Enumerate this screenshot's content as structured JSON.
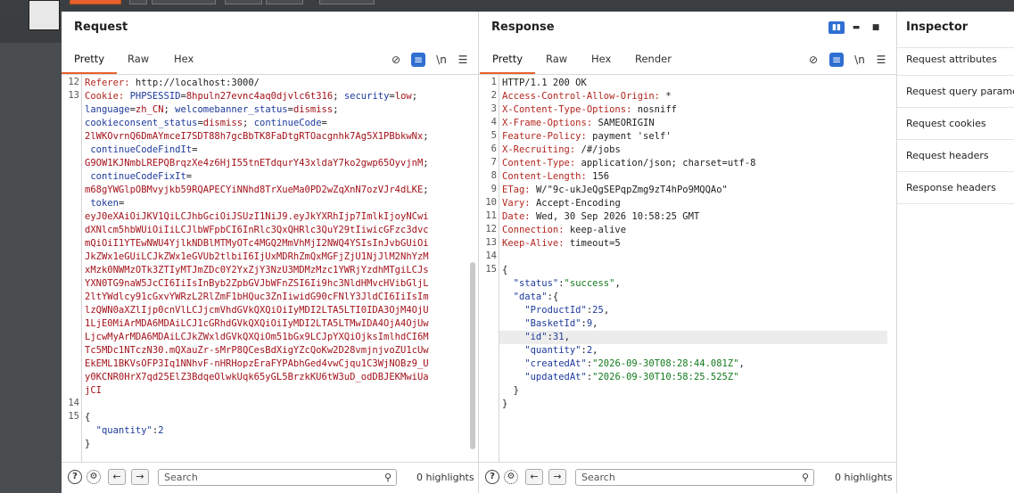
{
  "request": {
    "title": "Request",
    "tabs": [
      "Pretty",
      "Raw",
      "Hex"
    ],
    "lines": [
      {
        "n": "12",
        "segs": [
          {
            "t": "Referer: ",
            "c": "k"
          },
          {
            "t": "http://localhost:3000/",
            "c": "v"
          }
        ]
      },
      {
        "n": "13",
        "segs": [
          {
            "t": "Cookie: ",
            "c": "k"
          },
          {
            "t": "PHPSESSID",
            "c": "blue"
          },
          {
            "t": "=",
            "c": "v"
          },
          {
            "t": "8hpuln27evnc4aq0djvlc6t316",
            "c": "red"
          },
          {
            "t": "; ",
            "c": "v"
          },
          {
            "t": "security",
            "c": "blue"
          },
          {
            "t": "=",
            "c": "v"
          },
          {
            "t": "low",
            "c": "red"
          },
          {
            "t": ";",
            "c": "v"
          }
        ]
      },
      {
        "n": "",
        "segs": [
          {
            "t": "language",
            "c": "blue"
          },
          {
            "t": "=",
            "c": "v"
          },
          {
            "t": "zh_CN",
            "c": "red"
          },
          {
            "t": "; ",
            "c": "v"
          },
          {
            "t": "welcomebanner_status",
            "c": "blue"
          },
          {
            "t": "=",
            "c": "v"
          },
          {
            "t": "dismiss",
            "c": "red"
          },
          {
            "t": ";",
            "c": "v"
          }
        ]
      },
      {
        "n": "",
        "segs": [
          {
            "t": "cookieconsent_status",
            "c": "blue"
          },
          {
            "t": "=",
            "c": "v"
          },
          {
            "t": "dismiss",
            "c": "red"
          },
          {
            "t": "; ",
            "c": "v"
          },
          {
            "t": "continueCode",
            "c": "blue"
          },
          {
            "t": "=",
            "c": "v"
          }
        ]
      },
      {
        "n": "",
        "segs": [
          {
            "t": "2lWKOvrnQ6DmAYmceI7SDT88h7gcBbTK8FaDtgRTOacgnhk7Ag5X1PBbkwNx",
            "c": "red"
          },
          {
            "t": ";",
            "c": "v"
          }
        ]
      },
      {
        "n": "",
        "segs": [
          {
            "t": " continueCodeFindIt",
            "c": "blue"
          },
          {
            "t": "=",
            "c": "v"
          }
        ]
      },
      {
        "n": "",
        "segs": [
          {
            "t": "G9OW1KJNmbLREPQBrqzXe4z6HjI55tnETdqurY43xldaY7ko2gwp65OyvjnM",
            "c": "red"
          },
          {
            "t": ";",
            "c": "v"
          }
        ]
      },
      {
        "n": "",
        "segs": [
          {
            "t": " continueCodeFixIt",
            "c": "blue"
          },
          {
            "t": "=",
            "c": "v"
          }
        ]
      },
      {
        "n": "",
        "segs": [
          {
            "t": "m68gYWGlpOBMvyjkb59RQAPECYiNNhd8TrXueMa0PD2wZqXnN7ozVJr4dLKE",
            "c": "red"
          },
          {
            "t": ";",
            "c": "v"
          }
        ]
      },
      {
        "n": "",
        "segs": [
          {
            "t": " token",
            "c": "blue"
          },
          {
            "t": "=",
            "c": "v"
          }
        ]
      },
      {
        "n": "",
        "segs": [
          {
            "t": "eyJ0eXAiOiJKV1QiLCJhbGciOiJSUzI1NiJ9.eyJkYXRhIjp7ImlkIjoyNCwi",
            "c": "red"
          }
        ]
      },
      {
        "n": "",
        "segs": [
          {
            "t": "dXNlcm5hbWUiOiIiLCJlbWFpbCI6InRlc3QxQHRlc3QuY29tIiwicGFzc3dvc",
            "c": "red"
          }
        ]
      },
      {
        "n": "",
        "segs": [
          {
            "t": "mQiOiI1YTEwNWU4YjlkNDBlMTMyOTc4MGQ2MmVhMjI2NWQ4YSIsInJvbGUiOi",
            "c": "red"
          }
        ]
      },
      {
        "n": "",
        "segs": [
          {
            "t": "JkZWx1eGUiLCJkZWx1eGVUb2tlbiI6IjUxMDRhZmQxMGFjZjU1NjJlM2NhYzM",
            "c": "red"
          }
        ]
      },
      {
        "n": "",
        "segs": [
          {
            "t": "xMzk0NWMzOTk3ZTIyMTJmZDc0Y2YxZjY3NzU3MDMzMzc1YWRjYzdhMTgiLCJs",
            "c": "red"
          }
        ]
      },
      {
        "n": "",
        "segs": [
          {
            "t": "YXN0TG9naW5JcCI6IiIsInByb2ZpbGVJbWFnZSI6Ii9hc3NldHMvcHVibGljL",
            "c": "red"
          }
        ]
      },
      {
        "n": "",
        "segs": [
          {
            "t": "2ltYWdlcy91cGxvYWRzL2RlZmF1bHQuc3ZnIiwidG90cFNlY3JldCI6IiIsIm",
            "c": "red"
          }
        ]
      },
      {
        "n": "",
        "segs": [
          {
            "t": "lzQWN0aXZlIjp0cnVlLCJjcmVhdGVkQXQiOiIyMDI2LTA5LTI0IDA3OjM4OjU",
            "c": "red"
          }
        ]
      },
      {
        "n": "",
        "segs": [
          {
            "t": "1LjE0MiArMDA6MDAiLCJ1cGRhdGVkQXQiOiIyMDI2LTA5LTMwIDA4OjA4OjUw",
            "c": "red"
          }
        ]
      },
      {
        "n": "",
        "segs": [
          {
            "t": "LjcwMyArMDA6MDAiLCJkZWxldGVkQXQiOm51bGx9LCJpYXQiOjksImlhdCI6M",
            "c": "red"
          }
        ]
      },
      {
        "n": "",
        "segs": [
          {
            "t": "Tc5MDc1NTczN30.mQXauZr-sMrP8QCesBdXigYZcQoKw2D28vmjnjvoZU1cUw",
            "c": "red"
          }
        ]
      },
      {
        "n": "",
        "segs": [
          {
            "t": "EkEML1BKVsOFP3Iq1NNhvF-nHRHopzEraFYPAbhGed4vwCjqu1C3WjNOBz9_U",
            "c": "red"
          }
        ]
      },
      {
        "n": "",
        "segs": [
          {
            "t": "y0KCNR0HrX7qd25ElZ3BdqeOlwkUqk65yGL5BrzkKU6tW3uD_odDBJEKMwiUa",
            "c": "red"
          }
        ]
      },
      {
        "n": "",
        "segs": [
          {
            "t": "jCI",
            "c": "red"
          }
        ]
      },
      {
        "n": "14",
        "segs": []
      },
      {
        "n": "15",
        "segs": [
          {
            "t": "{",
            "c": "v"
          }
        ]
      },
      {
        "n": "",
        "segs": [
          {
            "t": "  \"quantity\"",
            "c": "blue"
          },
          {
            "t": ":",
            "c": "v"
          },
          {
            "t": "2",
            "c": "blue"
          }
        ]
      },
      {
        "n": "",
        "segs": [
          {
            "t": "}",
            "c": "v"
          }
        ]
      }
    ],
    "search_placeholder": "Search",
    "highlights": "0 highlights"
  },
  "response": {
    "title": "Response",
    "tabs": [
      "Pretty",
      "Raw",
      "Hex",
      "Render"
    ],
    "lines": [
      {
        "n": "1",
        "segs": [
          {
            "t": "HTTP/1.1 200 OK",
            "c": "v"
          }
        ]
      },
      {
        "n": "2",
        "segs": [
          {
            "t": "Access-Control-Allow-Origin: ",
            "c": "k"
          },
          {
            "t": "*",
            "c": "v"
          }
        ]
      },
      {
        "n": "3",
        "segs": [
          {
            "t": "X-Content-Type-Options: ",
            "c": "k"
          },
          {
            "t": "nosniff",
            "c": "v"
          }
        ]
      },
      {
        "n": "4",
        "segs": [
          {
            "t": "X-Frame-Options: ",
            "c": "k"
          },
          {
            "t": "SAMEORIGIN",
            "c": "v"
          }
        ]
      },
      {
        "n": "5",
        "segs": [
          {
            "t": "Feature-Policy: ",
            "c": "k"
          },
          {
            "t": "payment 'self'",
            "c": "v"
          }
        ]
      },
      {
        "n": "6",
        "segs": [
          {
            "t": "X-Recruiting: ",
            "c": "k"
          },
          {
            "t": "/#/jobs",
            "c": "v"
          }
        ]
      },
      {
        "n": "7",
        "segs": [
          {
            "t": "Content-Type: ",
            "c": "k"
          },
          {
            "t": "application/json; charset=utf-8",
            "c": "v"
          }
        ]
      },
      {
        "n": "8",
        "segs": [
          {
            "t": "Content-Length: ",
            "c": "k"
          },
          {
            "t": "156",
            "c": "v"
          }
        ]
      },
      {
        "n": "9",
        "segs": [
          {
            "t": "ETag: ",
            "c": "k"
          },
          {
            "t": "W/\"9c-ukJeQgSEPqpZmg9zT4hPo9MQQAo\"",
            "c": "v"
          }
        ]
      },
      {
        "n": "10",
        "segs": [
          {
            "t": "Vary: ",
            "c": "k"
          },
          {
            "t": "Accept-Encoding",
            "c": "v"
          }
        ]
      },
      {
        "n": "11",
        "segs": [
          {
            "t": "Date: ",
            "c": "k"
          },
          {
            "t": "Wed, 30 Sep 2026 10:58:25 GMT",
            "c": "v"
          }
        ]
      },
      {
        "n": "12",
        "segs": [
          {
            "t": "Connection: ",
            "c": "k"
          },
          {
            "t": "keep-alive",
            "c": "v"
          }
        ]
      },
      {
        "n": "13",
        "segs": [
          {
            "t": "Keep-Alive: ",
            "c": "k"
          },
          {
            "t": "timeout=5",
            "c": "v"
          }
        ]
      },
      {
        "n": "14",
        "segs": []
      },
      {
        "n": "15",
        "segs": [
          {
            "t": "{",
            "c": "v"
          }
        ]
      },
      {
        "n": "",
        "segs": [
          {
            "t": "  \"status\"",
            "c": "blue"
          },
          {
            "t": ":",
            "c": "v"
          },
          {
            "t": "\"success\"",
            "c": "green"
          },
          {
            "t": ",",
            "c": "v"
          }
        ]
      },
      {
        "n": "",
        "segs": [
          {
            "t": "  \"data\"",
            "c": "blue"
          },
          {
            "t": ":{",
            "c": "v"
          }
        ]
      },
      {
        "n": "",
        "segs": [
          {
            "t": "    \"ProductId\"",
            "c": "blue"
          },
          {
            "t": ":",
            "c": "v"
          },
          {
            "t": "25",
            "c": "blue"
          },
          {
            "t": ",",
            "c": "v"
          }
        ]
      },
      {
        "n": "",
        "segs": [
          {
            "t": "    \"BasketId\"",
            "c": "blue"
          },
          {
            "t": ":",
            "c": "v"
          },
          {
            "t": "9",
            "c": "blue"
          },
          {
            "t": ",",
            "c": "v"
          }
        ]
      },
      {
        "n": "",
        "segs": [
          {
            "t": "    \"id\"",
            "c": "blue"
          },
          {
            "t": ":",
            "c": "v"
          },
          {
            "t": "31",
            "c": "blue"
          },
          {
            "t": ",",
            "c": "v"
          }
        ],
        "highlighted": true
      },
      {
        "n": "",
        "segs": [
          {
            "t": "    \"quantity\"",
            "c": "blue"
          },
          {
            "t": ":",
            "c": "v"
          },
          {
            "t": "2",
            "c": "blue"
          },
          {
            "t": ",",
            "c": "v"
          }
        ]
      },
      {
        "n": "",
        "segs": [
          {
            "t": "    \"createdAt\"",
            "c": "blue"
          },
          {
            "t": ":",
            "c": "v"
          },
          {
            "t": "\"2026-09-30T08:28:44.081Z\"",
            "c": "green"
          },
          {
            "t": ",",
            "c": "v"
          }
        ]
      },
      {
        "n": "",
        "segs": [
          {
            "t": "    \"updatedAt\"",
            "c": "blue"
          },
          {
            "t": ":",
            "c": "v"
          },
          {
            "t": "\"2026-09-30T10:58:25.525Z\"",
            "c": "green"
          }
        ]
      },
      {
        "n": "",
        "segs": [
          {
            "t": "  }",
            "c": "v"
          }
        ]
      },
      {
        "n": "",
        "segs": [
          {
            "t": "}",
            "c": "v"
          }
        ]
      }
    ],
    "search_placeholder": "Search",
    "highlights": "0 highlights"
  },
  "inspector": {
    "title": "Inspector",
    "items": [
      "Request attributes",
      "Request query parameters",
      "Request cookies",
      "Request headers",
      "Response headers"
    ]
  },
  "icons": {
    "hide": "eye-slash-icon",
    "wrap": "wrap-lines-icon",
    "newline": "\\n",
    "menu": "hamburger-menu-icon",
    "help": "?",
    "settings": "gear-icon",
    "back": "←",
    "forward": "→",
    "search": "magnifier-icon"
  },
  "colors": {
    "accent": "#e8612c",
    "selected": "#2f6fd1"
  }
}
